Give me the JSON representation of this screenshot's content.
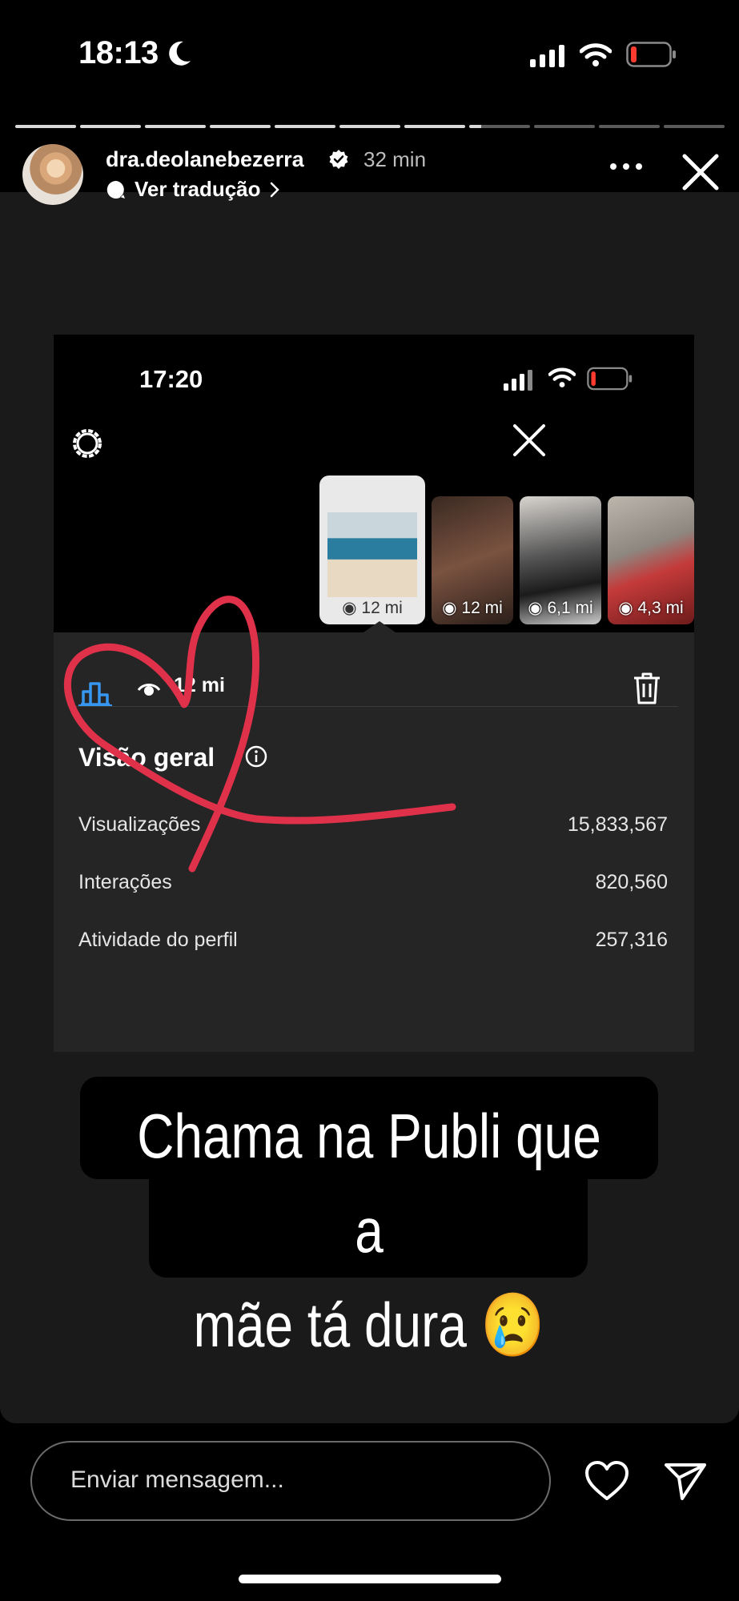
{
  "status_bar": {
    "time": "18:13",
    "icons": [
      "moon-icon",
      "signal-icon",
      "wifi-icon",
      "battery-low-icon"
    ]
  },
  "story": {
    "segments_total": 11,
    "segments_done": 7,
    "user": {
      "username": "dra.deolanebezerra",
      "verified": true,
      "age": "32 min"
    },
    "translate_label": "Ver tradução"
  },
  "screenshot": {
    "time": "17:20",
    "thumbnails": [
      {
        "views": "12 mi",
        "selected": true
      },
      {
        "views": "12 mi"
      },
      {
        "views": "6,1 mi"
      },
      {
        "views": "4,3 mi"
      }
    ],
    "panel": {
      "views": "12 mi",
      "overview_title": "Visão geral",
      "rows": [
        {
          "label": "Visualizações",
          "value": "15,833,567"
        },
        {
          "label": "Interações",
          "value": "820,560"
        },
        {
          "label": "Atividade do perfil",
          "value": "257,316"
        }
      ]
    }
  },
  "caption": {
    "line1": "Chama na Publi que a",
    "line2": "mãe tá dura 😢"
  },
  "footer": {
    "message_placeholder": "Enviar mensagem..."
  },
  "colors": {
    "accent_blue": "#3797f0",
    "heart_red": "#e0314b",
    "background": "#000000"
  }
}
